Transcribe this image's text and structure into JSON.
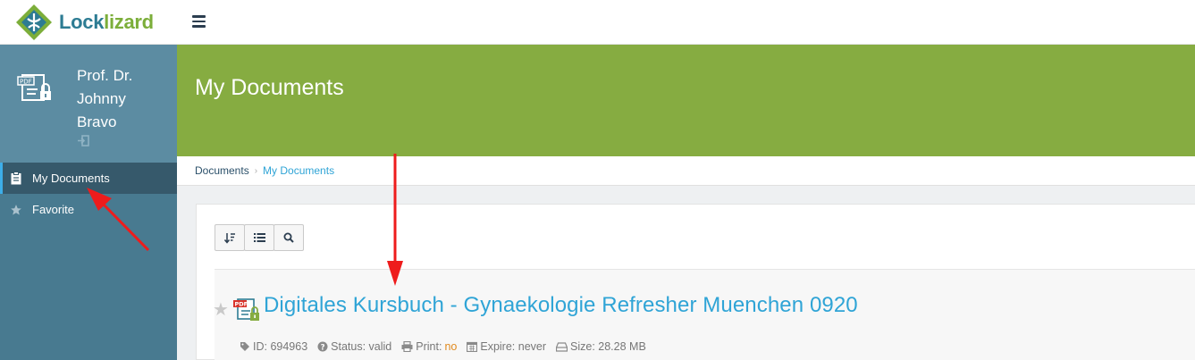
{
  "brand": {
    "name_part1": "Lock",
    "name_part2": "lizard"
  },
  "sidebar": {
    "user_name": "Prof. Dr. Johnny Bravo",
    "items": [
      {
        "label": "My Documents",
        "icon": "clipboard-icon",
        "active": true
      },
      {
        "label": "Favorite",
        "icon": "star-icon",
        "active": false
      }
    ]
  },
  "header": {
    "title": "My Documents"
  },
  "breadcrumb": {
    "root": "Documents",
    "current": "My Documents"
  },
  "document": {
    "title": "Digitales Kursbuch - Gynaekologie Refresher Muenchen 0920",
    "id_label": "ID: 694963",
    "status_label": "Status: valid",
    "print_label": "Print:",
    "print_value": "no",
    "expire_label": "Expire: never",
    "size_label": "Size: 28.28 MB"
  },
  "colors": {
    "header_green": "#86ac41",
    "sidebar_blue": "#487a90",
    "link_blue": "#2fa4d6",
    "arrow_red": "#ee1c1c"
  }
}
